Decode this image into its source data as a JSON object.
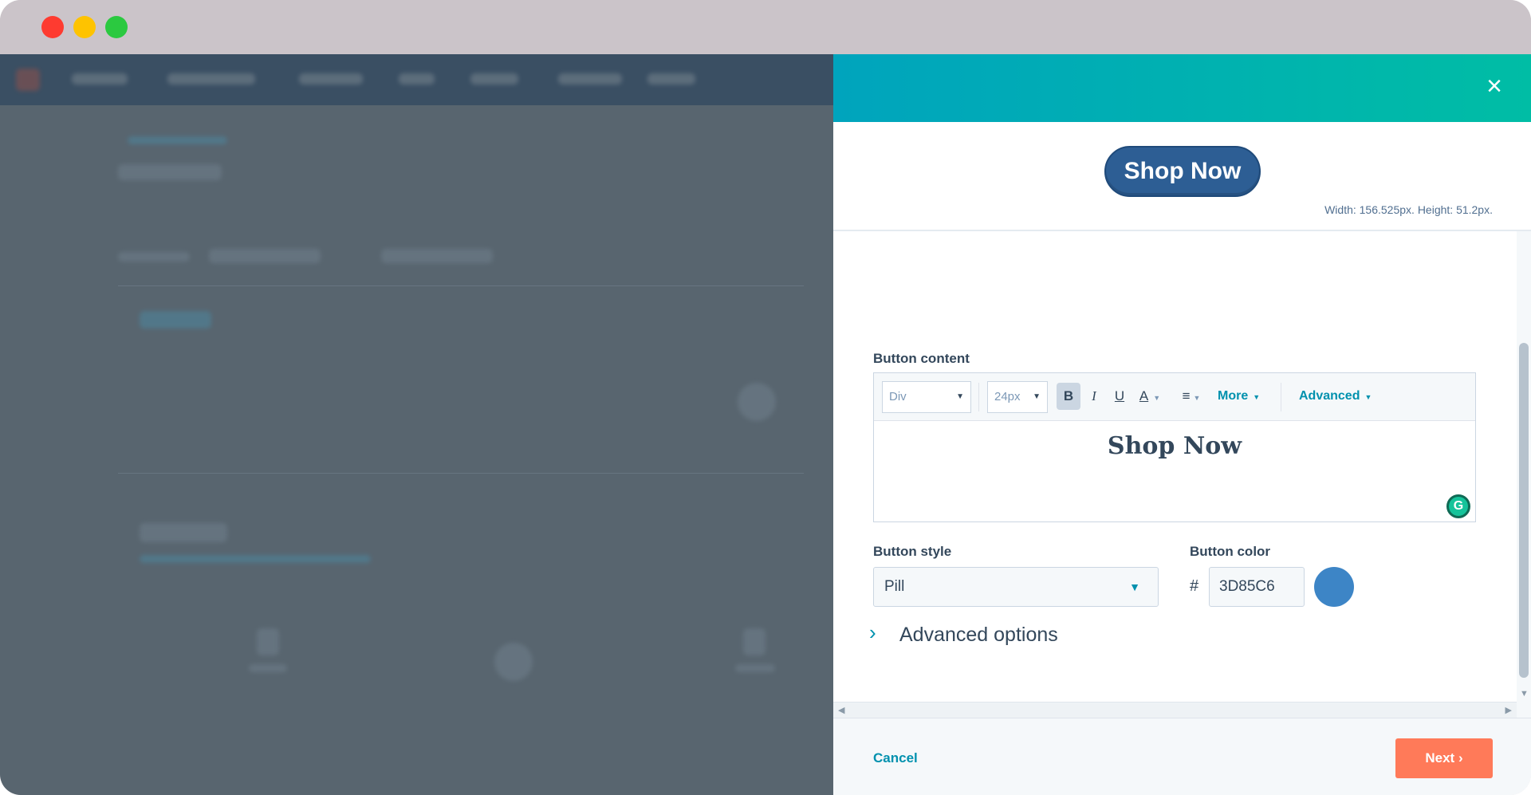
{
  "window": {
    "controls": [
      "close",
      "minimize",
      "maximize"
    ]
  },
  "panel": {
    "close_icon": "×",
    "preview": {
      "button_label": "Shop Now",
      "dimensions": "Width: 156.525px. Height: 51.2px."
    },
    "button_content": {
      "label": "Button content",
      "toolbar": {
        "block_type": "Div",
        "font_size": "24px",
        "bold": "B",
        "italic": "I",
        "underline": "U",
        "text_color": "A",
        "align_icon": "≡",
        "more": "More",
        "advanced": "Advanced"
      },
      "text": "Shop Now",
      "grammarly_icon": "G"
    },
    "button_style": {
      "label": "Button style",
      "value": "Pill"
    },
    "button_color": {
      "label": "Button color",
      "hash": "#",
      "value": "3D85C6",
      "swatch": "#3d85c6"
    },
    "advanced_options": {
      "label": "Advanced options",
      "chevron": "›"
    },
    "footer": {
      "cancel": "Cancel",
      "next": "Next ›"
    }
  }
}
